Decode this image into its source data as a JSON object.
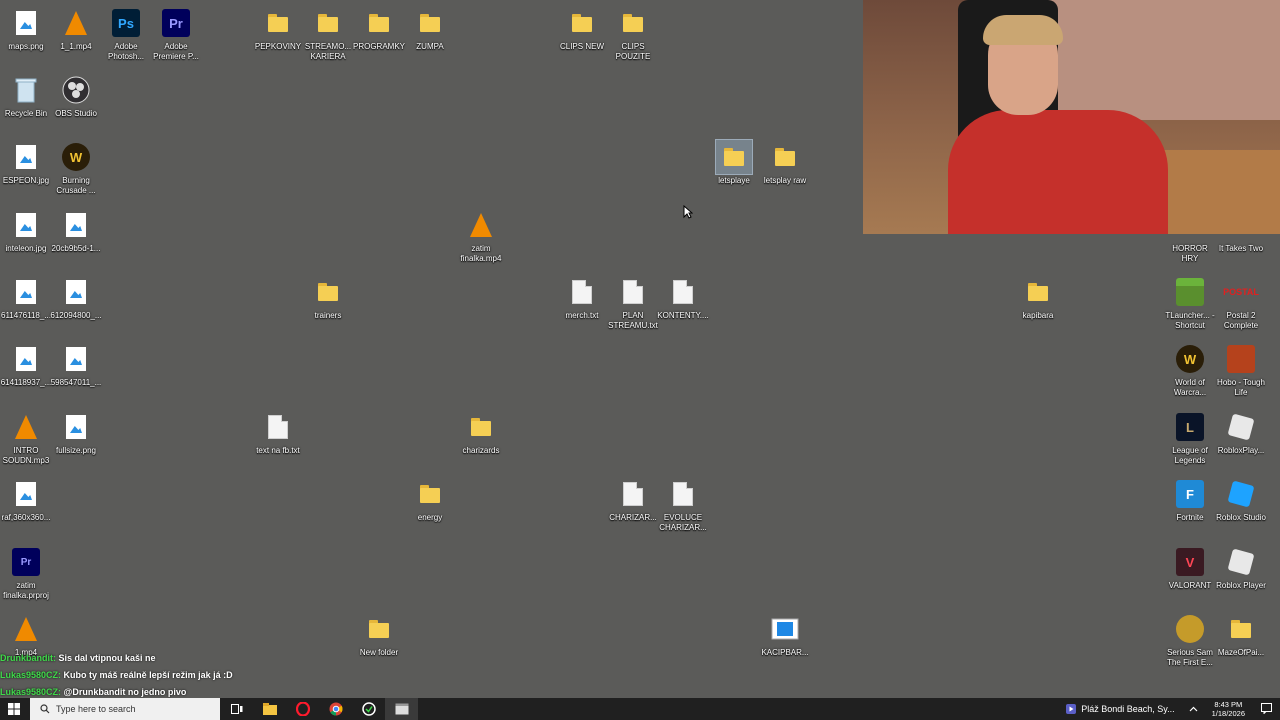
{
  "desktop": {
    "icons": [
      {
        "label": "maps.png"
      },
      {
        "label": "1_1.mp4"
      },
      {
        "label": "Adobe Photosh..."
      },
      {
        "label": "Adobe Premiere P..."
      },
      {
        "label": "PEPKOVINY"
      },
      {
        "label": "STREAMO... KARIERA"
      },
      {
        "label": "PROGRAMKY"
      },
      {
        "label": "ZUMPA"
      },
      {
        "label": "CLIPS NEW"
      },
      {
        "label": "CLIPS POUZITE"
      },
      {
        "label": "Recycle Bin"
      },
      {
        "label": "OBS Studio"
      },
      {
        "label": "ESPEON.jpg"
      },
      {
        "label": "Burning Crusade ..."
      },
      {
        "label": "letsplaye"
      },
      {
        "label": "letsplay raw"
      },
      {
        "label": "inteleon.jpg"
      },
      {
        "label": "20cb9b5d-1..."
      },
      {
        "label": "zatim finalka.mp4"
      },
      {
        "label": "611476118_..."
      },
      {
        "label": "612094800_..."
      },
      {
        "label": "trainers"
      },
      {
        "label": "merch.txt"
      },
      {
        "label": "PLAN STREAMU.txt"
      },
      {
        "label": "KONTENTY...."
      },
      {
        "label": "kapibara"
      },
      {
        "label": "614118937_..."
      },
      {
        "label": "598547011_..."
      },
      {
        "label": "INTRO SOUDN.mp3"
      },
      {
        "label": "fullsize.png"
      },
      {
        "label": "text na fb.txt"
      },
      {
        "label": "charizards"
      },
      {
        "label": "raf,360x360..."
      },
      {
        "label": "energy"
      },
      {
        "label": "CHARIZAR..."
      },
      {
        "label": "EVOLUCE CHARIZAR..."
      },
      {
        "label": "zatim finalka.prproj"
      },
      {
        "label": "1.mp4"
      },
      {
        "label": "New folder"
      },
      {
        "label": "KACIPBAR..."
      },
      {
        "label": "HORROR HRY"
      },
      {
        "label": "It Takes Two"
      },
      {
        "label": "TLauncher... - Shortcut"
      },
      {
        "label": "Postal 2 Complete"
      },
      {
        "label": "World of Warcra..."
      },
      {
        "label": "Hobo - Tough Life"
      },
      {
        "label": "League of Legends"
      },
      {
        "label": "RobloxPlay..."
      },
      {
        "label": "Fortnite"
      },
      {
        "label": "Roblox Studio"
      },
      {
        "label": "VALORANT"
      },
      {
        "label": "Roblox Player"
      },
      {
        "label": "Serious Sam The First E..."
      },
      {
        "label": "MazeOfPai..."
      }
    ]
  },
  "chat": {
    "lines": [
      {
        "user": "Drunkbandit:",
        "text": "Sis dal vtipnou kaši ne"
      },
      {
        "user": "Lukas9580CZ:",
        "text": "Kubo ty máš reálně lepší režim jak já :D"
      },
      {
        "user": "Lukas9580CZ:",
        "text": "@Drunkbandit no jedno pivo"
      }
    ]
  },
  "taskbar": {
    "search_placeholder": "Type here to search",
    "media_title": "Pláž Bondi Beach, Sy...",
    "time": "8:43 PM",
    "date": "1/18/2026"
  },
  "colors": {
    "desktop_bg": "#5b5b59",
    "taskbar_bg": "#202020",
    "folder": "#f5cf54",
    "chat_username": "#3fd94a"
  }
}
